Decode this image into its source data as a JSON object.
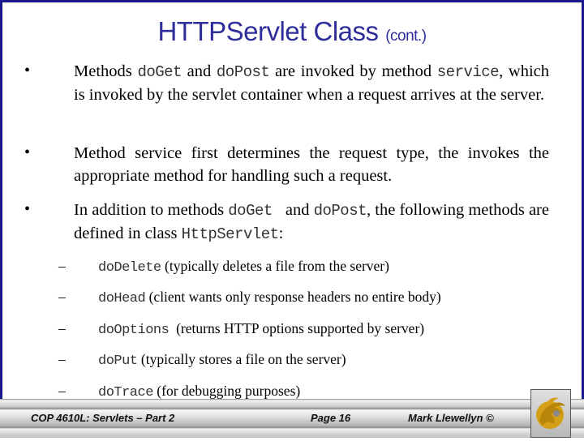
{
  "slide": {
    "title": "HTTPServlet Class",
    "title_suffix": "(cont.)",
    "bullets": [
      {
        "marker": "•",
        "parts": [
          {
            "t": "Methods "
          },
          {
            "code": "doGet"
          },
          {
            "t": " and "
          },
          {
            "code": "doPost"
          },
          {
            "t": " are invoked by method "
          },
          {
            "code": "service"
          },
          {
            "t": ", which is invoked by the servlet container when a request arrives at the server."
          }
        ]
      },
      {
        "marker": "•",
        "parts": [
          {
            "t": "Method service first determines the request type, the invokes the appropriate method for handling such a request."
          }
        ]
      },
      {
        "marker": "•",
        "parts": [
          {
            "t": "In addition to methods "
          },
          {
            "code": "doGet "
          },
          {
            "t": " and "
          },
          {
            "code": "doPost"
          },
          {
            "t": ", the following methods are defined in class "
          },
          {
            "code": "HttpServlet"
          },
          {
            "t": ":"
          }
        ]
      }
    ],
    "sub_items": [
      {
        "marker": "–",
        "method": "doDelete",
        "desc": " (typically deletes a file from the server)"
      },
      {
        "marker": "–",
        "method": "doHead",
        "desc": " (client wants only response headers no entire body)"
      },
      {
        "marker": "–",
        "method": "doOptions",
        "desc": "  (returns HTTP options supported by server)"
      },
      {
        "marker": "–",
        "method": "doPut",
        "desc": " (typically stores a file on the server)"
      },
      {
        "marker": "–",
        "method": "doTrace",
        "desc": " (for debugging purposes)"
      }
    ]
  },
  "footer": {
    "course": "COP 4610L: Servlets – Part 2",
    "page": "Page 16",
    "author": "Mark Llewellyn ©",
    "logo": "ucf-pegasus-logo"
  },
  "colors": {
    "border": "#1a1a8c",
    "title": "#2e2e9a",
    "logo_gold": "#d4a017"
  }
}
